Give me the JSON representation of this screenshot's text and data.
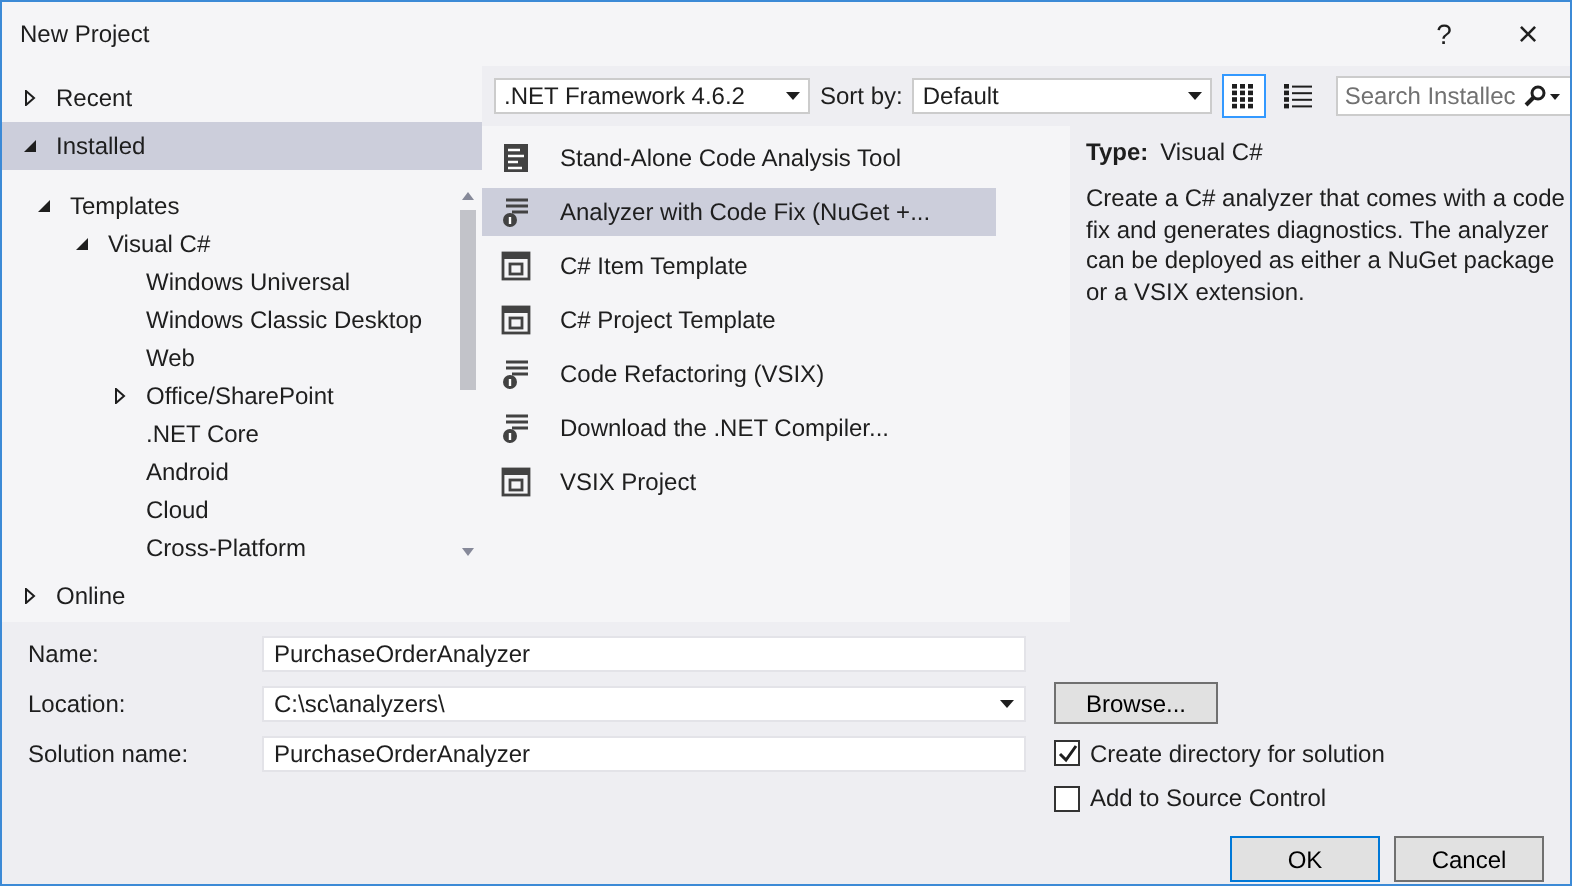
{
  "window": {
    "title": "New Project",
    "buttons": [
      {
        "kind": "help",
        "label": "?"
      },
      {
        "kind": "close",
        "label": "×"
      }
    ]
  },
  "sidebar": {
    "sections": [
      {
        "label": "Recent",
        "expanded": false,
        "selected": false
      },
      {
        "label": "Installed",
        "expanded": true,
        "selected": true,
        "children": [
          {
            "label": "Templates",
            "kind": "group",
            "expanded": true,
            "children": [
              {
                "label": "Visual C#",
                "kind": "group",
                "expanded": true,
                "children": [
                  {
                    "label": "Windows Universal",
                    "kind": "leaf"
                  },
                  {
                    "label": "Windows Classic Desktop",
                    "kind": "leaf"
                  },
                  {
                    "label": "Web",
                    "kind": "leaf"
                  },
                  {
                    "label": "Office/SharePoint",
                    "kind": "group",
                    "expanded": false
                  },
                  {
                    "label": ".NET Core",
                    "kind": "leaf"
                  },
                  {
                    "label": "Android",
                    "kind": "leaf"
                  },
                  {
                    "label": "Cloud",
                    "kind": "leaf"
                  },
                  {
                    "label": "Cross-Platform",
                    "kind": "leaf"
                  }
                ]
              }
            ]
          }
        ]
      },
      {
        "label": "Online",
        "expanded": false,
        "selected": false
      }
    ]
  },
  "toolbar": {
    "framework": ".NET Framework 4.6.2",
    "sort_label": "Sort by:",
    "sort": "Default",
    "views": [
      {
        "kind": "grid",
        "selected": true
      },
      {
        "kind": "list",
        "selected": false
      }
    ],
    "search": {
      "placeholder": "Search Installec"
    }
  },
  "templates": [
    {
      "name": "Stand-Alone Code Analysis Tool",
      "kind": "tool",
      "selected": false
    },
    {
      "name": "Analyzer with Code Fix (NuGet +...",
      "kind": "analyzer",
      "selected": true
    },
    {
      "name": "C# Item Template",
      "kind": "template",
      "selected": false
    },
    {
      "name": "C# Project Template",
      "kind": "template",
      "selected": false
    },
    {
      "name": "Code Refactoring (VSIX)",
      "kind": "analyzer",
      "selected": false
    },
    {
      "name": "Download the .NET Compiler...",
      "kind": "analyzer",
      "selected": false
    },
    {
      "name": "VSIX Project",
      "kind": "template",
      "selected": false
    }
  ],
  "details": {
    "type_label": "Type:",
    "type_value": "Visual C#",
    "description": "Create a C# analyzer that comes with a code fix and generates diagnostics. The analyzer can be deployed as either a NuGet package or a VSIX extension."
  },
  "form": {
    "fields": [
      {
        "label": "Name:",
        "value": "PurchaseOrderAnalyzer",
        "kind": "text"
      },
      {
        "label": "Location:",
        "value": "C:\\sc\\analyzers\\",
        "kind": "dropdown"
      },
      {
        "label": "Solution name:",
        "value": "PurchaseOrderAnalyzer",
        "kind": "text"
      }
    ],
    "browse": "Browse...",
    "options": [
      {
        "label": "Create directory for solution",
        "checked": true
      },
      {
        "label": "Add to Source Control",
        "checked": false
      }
    ]
  },
  "buttons": [
    {
      "label": "OK",
      "kind": "default"
    },
    {
      "label": "Cancel",
      "kind": "normal"
    }
  ]
}
